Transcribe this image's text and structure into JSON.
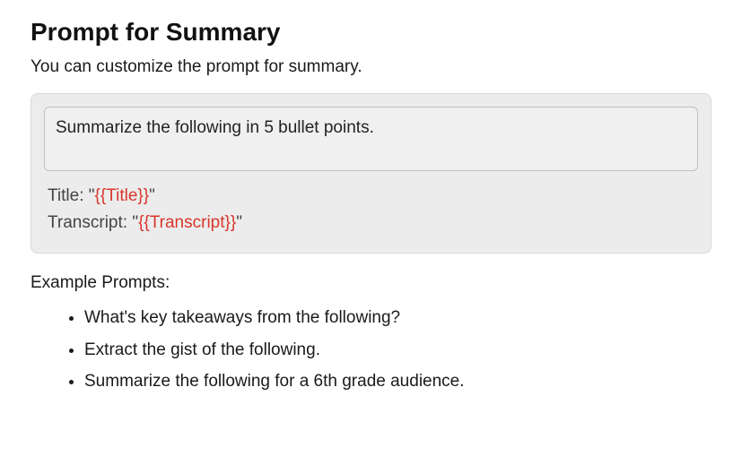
{
  "header": {
    "title": "Prompt for Summary",
    "description": "You can customize the prompt for summary."
  },
  "prompt": {
    "value": "Summarize the following in 5 bullet points.",
    "template": {
      "title_prefix": "Title: \"",
      "title_var": "{{Title}}",
      "title_suffix": "\"",
      "transcript_prefix": "Transcript: \"",
      "transcript_var": "{{Transcript}}",
      "transcript_suffix": "\""
    }
  },
  "examples": {
    "heading": "Example Prompts:",
    "items": [
      "What's key takeaways from the following?",
      "Extract the gist of the following.",
      "Summarize the following for a 6th grade audience."
    ]
  }
}
